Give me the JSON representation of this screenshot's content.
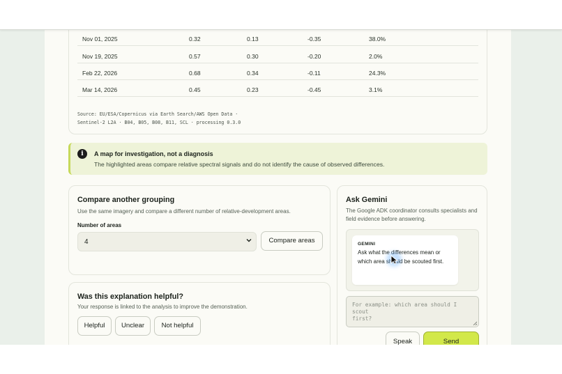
{
  "table": {
    "rows": [
      [
        "Nov 01, 2025",
        "0.32",
        "0.13",
        "-0.35",
        "38.0%"
      ],
      [
        "Nov 19, 2025",
        "0.57",
        "0.30",
        "-0.20",
        "2.0%"
      ],
      [
        "Feb 22, 2026",
        "0.68",
        "0.34",
        "-0.11",
        "24.3%"
      ],
      [
        "Mar 14, 2026",
        "0.45",
        "0.23",
        "-0.45",
        "3.1%"
      ]
    ],
    "source_line1": "Source: EU/ESA/Copernicus via Earth Search/AWS Open Data ·",
    "source_line2": "Sentinel-2 L2A · B04, B05, B08, B11, SCL · processing 0.3.0"
  },
  "notice": {
    "icon": "info-icon",
    "title": "A map for investigation, not a diagnosis",
    "body": "The highlighted areas compare relative spectral signals and do not identify the cause of observed differences."
  },
  "compare": {
    "title": "Compare another grouping",
    "subtitle": "Use the same imagery and compare a different number of relative-development areas.",
    "field_label": "Number of areas",
    "selected_value": "4",
    "button_label": "Compare areas"
  },
  "feedback": {
    "title": "Was this explanation helpful?",
    "subtitle": "Your response is linked to the analysis to improve the demonstration.",
    "buttons": [
      "Helpful",
      "Unclear",
      "Not helpful"
    ]
  },
  "gemini": {
    "title": "Ask Gemini",
    "subtitle_line1": "The Google ADK coordinator consults specialists and",
    "subtitle_line2": "field evidence before answering.",
    "speaker": "GEMINI",
    "message_line1": "Ask what the differences mean or",
    "message_line2": "which area should be scouted first.",
    "input_placeholder_line1": "For example: which area should I scout",
    "input_placeholder_line2": "first?",
    "speak_label": "Speak",
    "send_label": "Send"
  },
  "colors": {
    "accent": "#d2e84a",
    "notice_bg": "#eef3d8",
    "page_bg": "#fbfbf6"
  }
}
